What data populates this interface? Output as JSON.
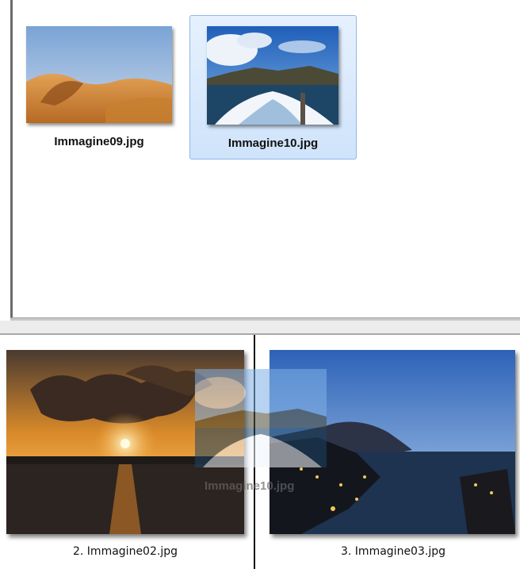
{
  "explorer": {
    "files": [
      {
        "name": "Immagine09.jpg",
        "selected": false
      },
      {
        "name": "Immagine10.jpg",
        "selected": true
      }
    ]
  },
  "filmstrip": {
    "items": [
      {
        "caption": "2. Immagine02.jpg"
      },
      {
        "caption": "3. Immagine03.jpg"
      }
    ]
  },
  "drag": {
    "label": "Immagine10.jpg"
  },
  "colors": {
    "selection_bg": "#cfe3fb",
    "selection_border": "#8fb8ea"
  }
}
